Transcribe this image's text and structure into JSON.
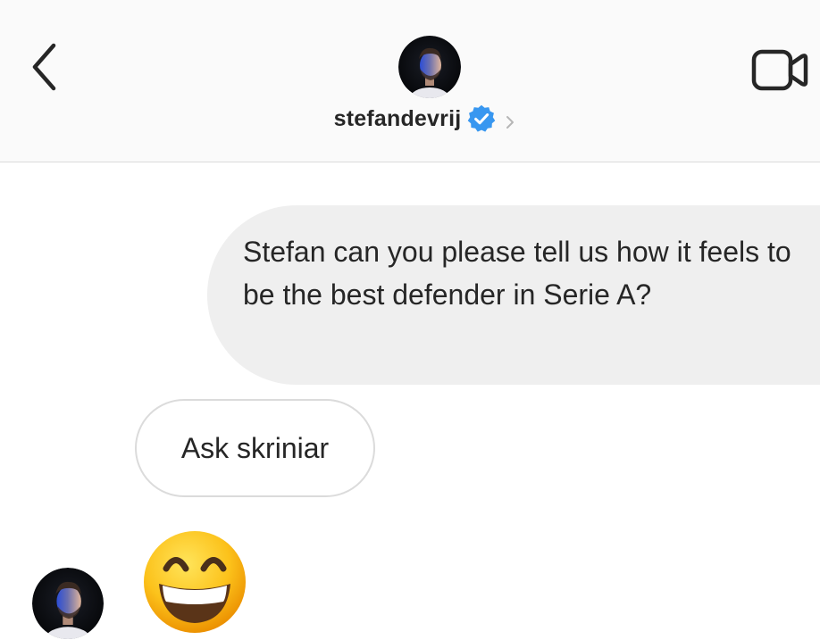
{
  "header": {
    "username": "stefandevrij",
    "verified": true,
    "avatar_icon": "profile-photo",
    "back_icon": "chevron-left-icon",
    "video_icon": "video-camera-icon",
    "accent_color": "#3897f0"
  },
  "messages": [
    {
      "direction": "outgoing",
      "text": "Stefan can you please tell us how it feels to be the best defender in Serie A?"
    },
    {
      "direction": "incoming",
      "text": "Ask skriniar"
    },
    {
      "direction": "incoming",
      "type": "emoji",
      "emoji": "grinning-face-with-big-eyes"
    }
  ]
}
